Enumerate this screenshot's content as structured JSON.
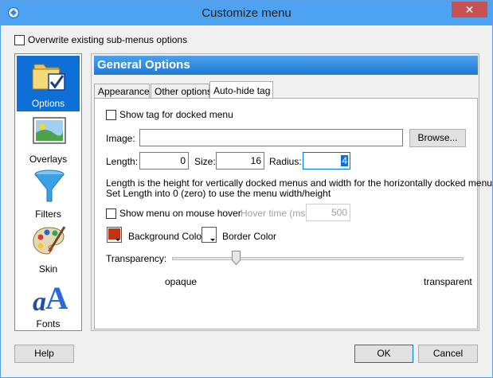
{
  "window": {
    "title": "Customize menu",
    "close_glyph": "✕"
  },
  "overwrite_label": "Overwrite existing sub-menus options",
  "sidebar": {
    "items": [
      {
        "label": "Options",
        "icon": "folder-check-icon"
      },
      {
        "label": "Overlays",
        "icon": "picture-icon"
      },
      {
        "label": "Filters",
        "icon": "funnel-icon"
      },
      {
        "label": "Skin",
        "icon": "palette-icon"
      },
      {
        "label": "Fonts",
        "icon": "font-icon"
      }
    ],
    "active": "Options"
  },
  "panel": {
    "title": "General Options"
  },
  "tabs": [
    "Appearance",
    "Other options",
    "Auto-hide tag"
  ],
  "active_tab": "Auto-hide tag",
  "autohide": {
    "show_tag_label": "Show tag for docked menu",
    "image_label": "Image:",
    "image_value": "",
    "browse_label": "Browse...",
    "length_label": "Length:",
    "length_value": "0",
    "size_label": "Size:",
    "size_value": "16",
    "radius_label": "Radius:",
    "radius_value": "4",
    "help_line1": "Length is the height for vertically docked menus and width for the horizontally docked menus.",
    "help_line2": "Set Length into 0 (zero) to use the menu width/height",
    "hover_label": "Show menu on mouse hover",
    "hover_time_label": "Hover time (ms):",
    "hover_time_value": "500",
    "bg_color_label": "Background Color",
    "border_color_label": "Border Color",
    "transparency_label": "Transparency:",
    "opaque_label": "opaque",
    "transparent_label": "transparent",
    "transparency_level": 0.22
  },
  "footer": {
    "help_label": "Help",
    "ok_label": "OK",
    "cancel_label": "Cancel"
  },
  "colors": {
    "accent": "#0e6fd6",
    "titlebar": "#4da3f2",
    "close": "#c75050",
    "background_swatch": "#c0340f",
    "border_swatch": "#ffffff"
  }
}
